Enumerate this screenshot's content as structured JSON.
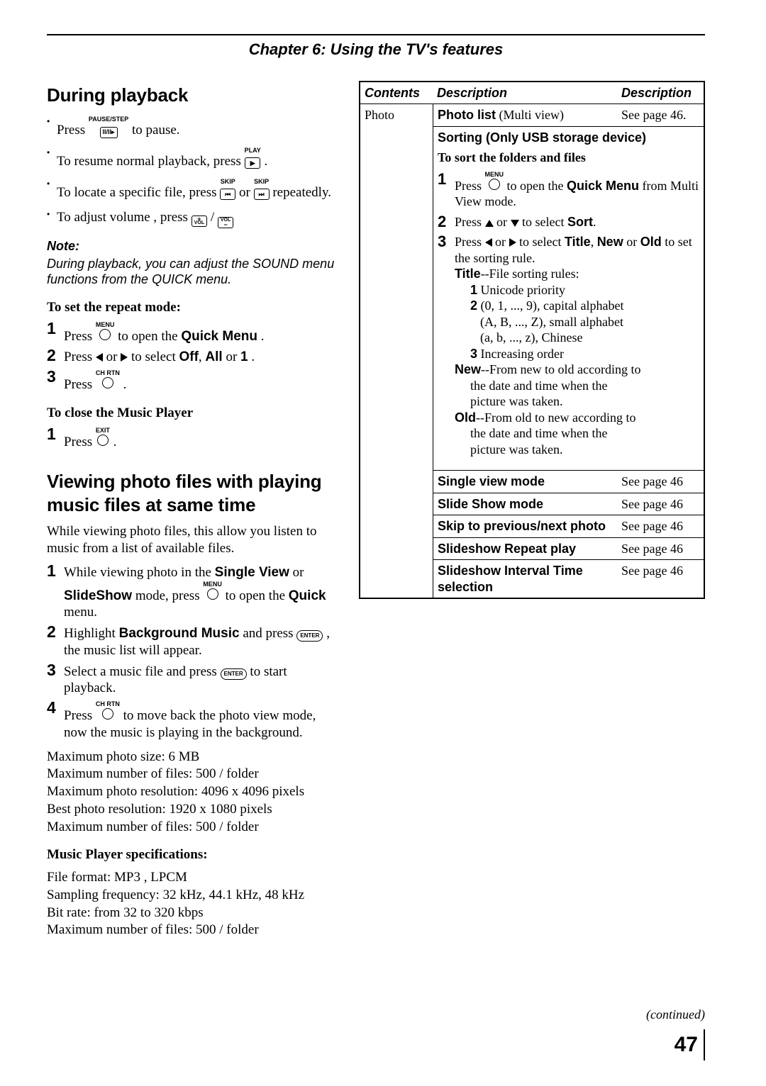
{
  "chapter_title": "Chapter 6: Using the TV's features",
  "left": {
    "h_playback": "During playback",
    "bul_pause_a": "Press ",
    "bul_pause_b": " to pause.",
    "key_pause_label": "PAUSE/STEP",
    "key_pause_glyph": "II/II▸",
    "bul_resume_a": "To resume normal playback, press ",
    "bul_resume_b": ".",
    "key_play_label": "PLAY",
    "key_play_glyph": "▶",
    "bul_skip_a": "To locate a specific file, press ",
    "bul_skip_mid": " or ",
    "bul_skip_b": " repeatedly.",
    "key_skip_label": "SKIP",
    "key_skip_prev": "⏮",
    "key_skip_next": "⏭",
    "bul_vol_a": "To adjust volume , press ",
    "bul_vol_sep": " / ",
    "key_vol_up": "+",
    "key_vol_dn": "−",
    "key_vol_txt": "VOL",
    "note_label": "Note:",
    "note_text": "During playback, you can adjust the SOUND menu functions from the QUICK menu.",
    "sub_repeat": "To set the repeat mode:",
    "rep_1a": "Press ",
    "key_menu_label": "MENU",
    "rep_1b": " to open the ",
    "rep_1c": "Quick Menu",
    "rep_1d": ".",
    "rep_2a": "Press ",
    "rep_2mid": " or ",
    "rep_2b": " to select ",
    "rep_2_off": "Off",
    "rep_2_all": "All",
    "rep_2_or": " or ",
    "rep_2_one": "1",
    "rep_2_end": ".",
    "rep_3a": "Press ",
    "key_chrtn_label": "CH RTN",
    "rep_3b": ".",
    "sub_close": "To close the Music Player",
    "close_1a": "Press ",
    "key_exit_label": "EXIT",
    "close_1b": ".",
    "h_photo": "Viewing photo files with playing music files at same time",
    "photo_intro": "While viewing photo files, this allow you listen to music from a list of available files.",
    "ph_1a": "While viewing photo in the ",
    "ph_1_sv": "Single View",
    "ph_1_or": " or ",
    "ph_1_ss": "SlideShow",
    "ph_1b": " mode, press ",
    "ph_1c": " to open the ",
    "ph_1_quick": "Quick",
    "ph_1d": " menu.",
    "ph_2a": "Highlight ",
    "ph_2_bg": "Background Music",
    "ph_2b": " and press ",
    "key_enter": "ENTER",
    "ph_2c": ", the music list will appear.",
    "ph_3a": "Select a music file and press ",
    "ph_3b": " to start playback.",
    "ph_4a": "Press ",
    "ph_4b": " to move back the photo view mode, now the music is playing in the background.",
    "specs_photo": [
      "Maximum photo size: 6 MB",
      "Maximum number of files: 500 / folder",
      "Maximum photo resolution: 4096 x 4096 pixels",
      "Best photo resolution: 1920 x 1080 pixels",
      "Maximum number of files: 500 / folder"
    ],
    "sub_musicspec": "Music Player specifications:",
    "specs_music": [
      "File format: MP3 , LPCM",
      "Sampling frequency: 32 kHz, 44.1 kHz, 48 kHz",
      "Bit rate: from 32 to 320 kbps",
      "Maximum number of files: 500 / folder"
    ]
  },
  "right": {
    "th_a": "Contents",
    "th_b": "Description",
    "th_c": "Description",
    "photo_label": "Photo",
    "row1_b_bold": "Photo list",
    "row1_b_rest": " (Multi view)",
    "row1_c": "See page 46.",
    "sort_h1": "Sorting (Only USB storage device)",
    "sort_h2": "To sort the folders and files",
    "s1a": "Press ",
    "s1b": " to open the ",
    "s1_qm": "Quick Menu",
    "s1c": " from Multi View mode.",
    "s2a": "Press ",
    "s2mid": " or ",
    "s2b": " to select ",
    "s2_sort": "Sort",
    "s2c": ".",
    "s3a": "Press ",
    "s3mid": " or ",
    "s3b": " to select ",
    "s3_title": "Title",
    "s3_comma": ", ",
    "s3_new": "New",
    "s3_or": " or ",
    "s3_old": "Old",
    "s3c": " to set the sorting rule.",
    "t_title": "Title",
    "t_title_rest": "--File sorting rules:",
    "t_r1n": "1",
    "t_r1": " Unicode priority",
    "t_r2n": "2",
    "t_r2a": " (0, 1, ..., 9), capital alphabet",
    "t_r2b": "(A, B, ..., Z), small alphabet",
    "t_r2c": "(a, b, ..., z), Chinese",
    "t_r3n": "3",
    "t_r3": " Increasing order",
    "t_new": "New",
    "t_new_rest1": "--From new to old according to",
    "t_new_rest2": "the date and time when the",
    "t_new_rest3": "picture was taken.",
    "t_old": "Old",
    "t_old_rest1": "--From old to new according to",
    "t_old_rest2": "the date and time when the",
    "t_old_rest3": "picture was taken.",
    "rows": [
      {
        "b": "Single view mode",
        "c": "See page 46"
      },
      {
        "b": "Slide Show mode",
        "c": "See page 46"
      },
      {
        "b": "Skip to previous/next photo",
        "c": "See page 46"
      },
      {
        "b": "Slideshow Repeat play",
        "c": "See page 46"
      },
      {
        "b": "Slideshow Interval Time selection",
        "c": "See page 46"
      }
    ]
  },
  "continued": "(continued)",
  "page_number": "47"
}
